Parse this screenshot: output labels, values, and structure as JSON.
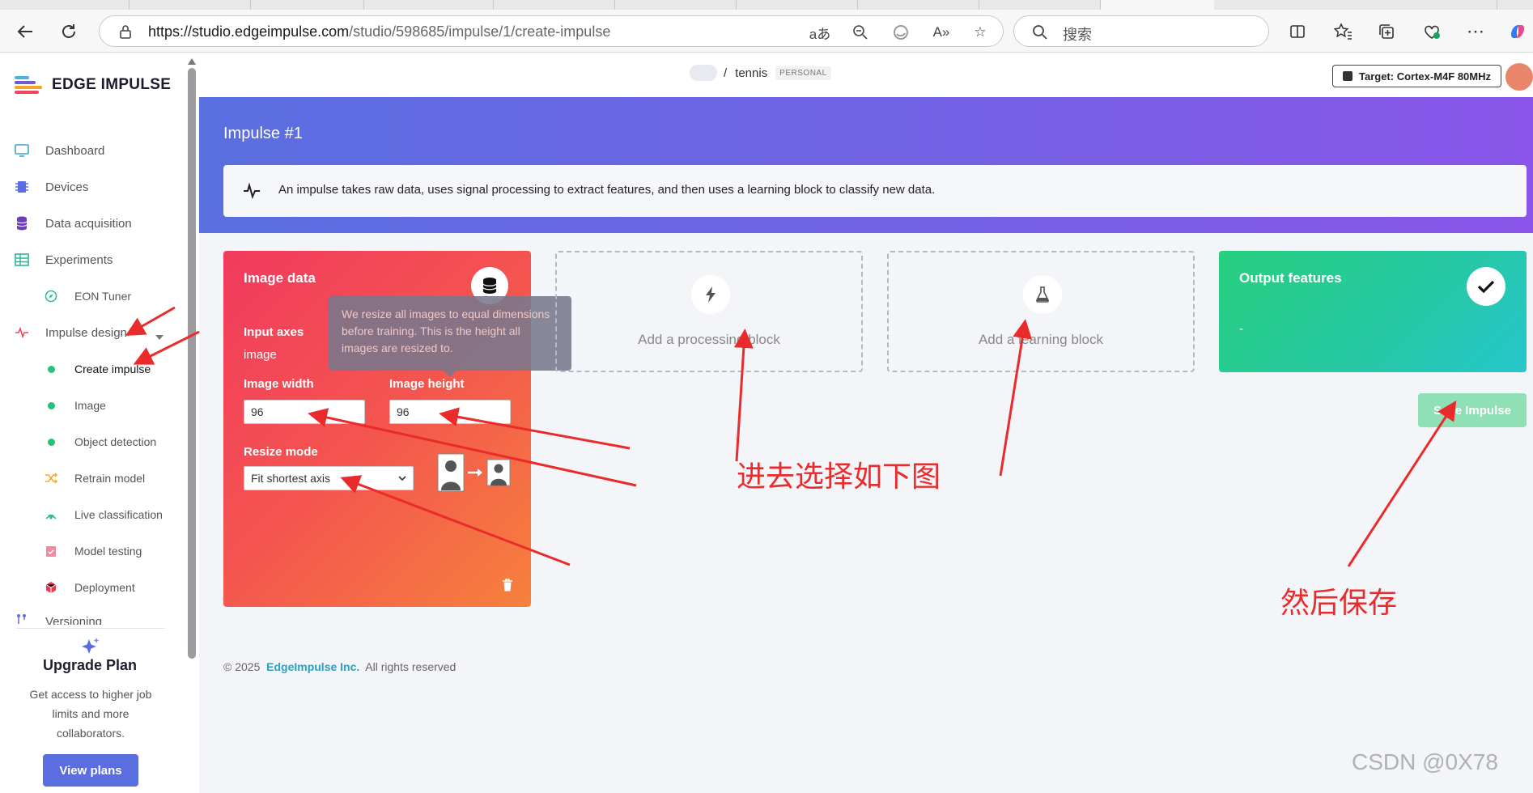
{
  "browser": {
    "url_host": "https://studio.edgeimpulse.com",
    "url_path": "/studio/598685/impulse/1/create-impulse",
    "search_placeholder": "搜索"
  },
  "sidebar": {
    "brand": "EDGE IMPULSE",
    "items": [
      {
        "label": "Dashboard"
      },
      {
        "label": "Devices"
      },
      {
        "label": "Data acquisition"
      },
      {
        "label": "Experiments"
      },
      {
        "label": "EON Tuner"
      },
      {
        "label": "Impulse design"
      },
      {
        "label": "Create impulse"
      },
      {
        "label": "Image"
      },
      {
        "label": "Object detection"
      },
      {
        "label": "Retrain model"
      },
      {
        "label": "Live classification"
      },
      {
        "label": "Model testing"
      },
      {
        "label": "Deployment"
      },
      {
        "label": "Versioning"
      }
    ],
    "upgrade": {
      "title": "Upgrade Plan",
      "description": "Get access to higher job limits and more collaborators.",
      "button": "View plans"
    }
  },
  "topbar": {
    "project_separator": "/",
    "project_name": "tennis",
    "project_badge": "PERSONAL",
    "target": "Target: Cortex-M4F 80MHz"
  },
  "header": {
    "title": "Impulse #1",
    "info": "An impulse takes raw data, uses signal processing to extract features, and then uses a learning block to classify new data."
  },
  "image_block": {
    "title": "Image data",
    "input_axes_label": "Input axes",
    "input_axes_value": "image",
    "width_label": "Image width",
    "width_value": "96",
    "height_label": "Image height",
    "height_value": "96",
    "resize_mode_label": "Resize mode",
    "resize_mode_value": "Fit shortest axis",
    "tooltip": "We resize all images to equal dimensions before training. This is the height all images are resized to."
  },
  "processing_block": {
    "label": "Add a processing block"
  },
  "learning_block": {
    "label": "Add a learning block"
  },
  "output_block": {
    "title": "Output features",
    "value": "-"
  },
  "save_button": "Save Impulse",
  "footer": {
    "prefix": "© 2025",
    "company": "EdgeImpulse Inc.",
    "suffix": "All rights reserved"
  },
  "annotations": {
    "select_note": "进去选择如下图",
    "save_note": "然后保存"
  },
  "watermark": "CSDN @0X78",
  "colors": {
    "accent": "#5b6ee1",
    "image_block": "#f23a5e",
    "output_block": "#27cf7e",
    "annotation": "#ea2b2b"
  }
}
